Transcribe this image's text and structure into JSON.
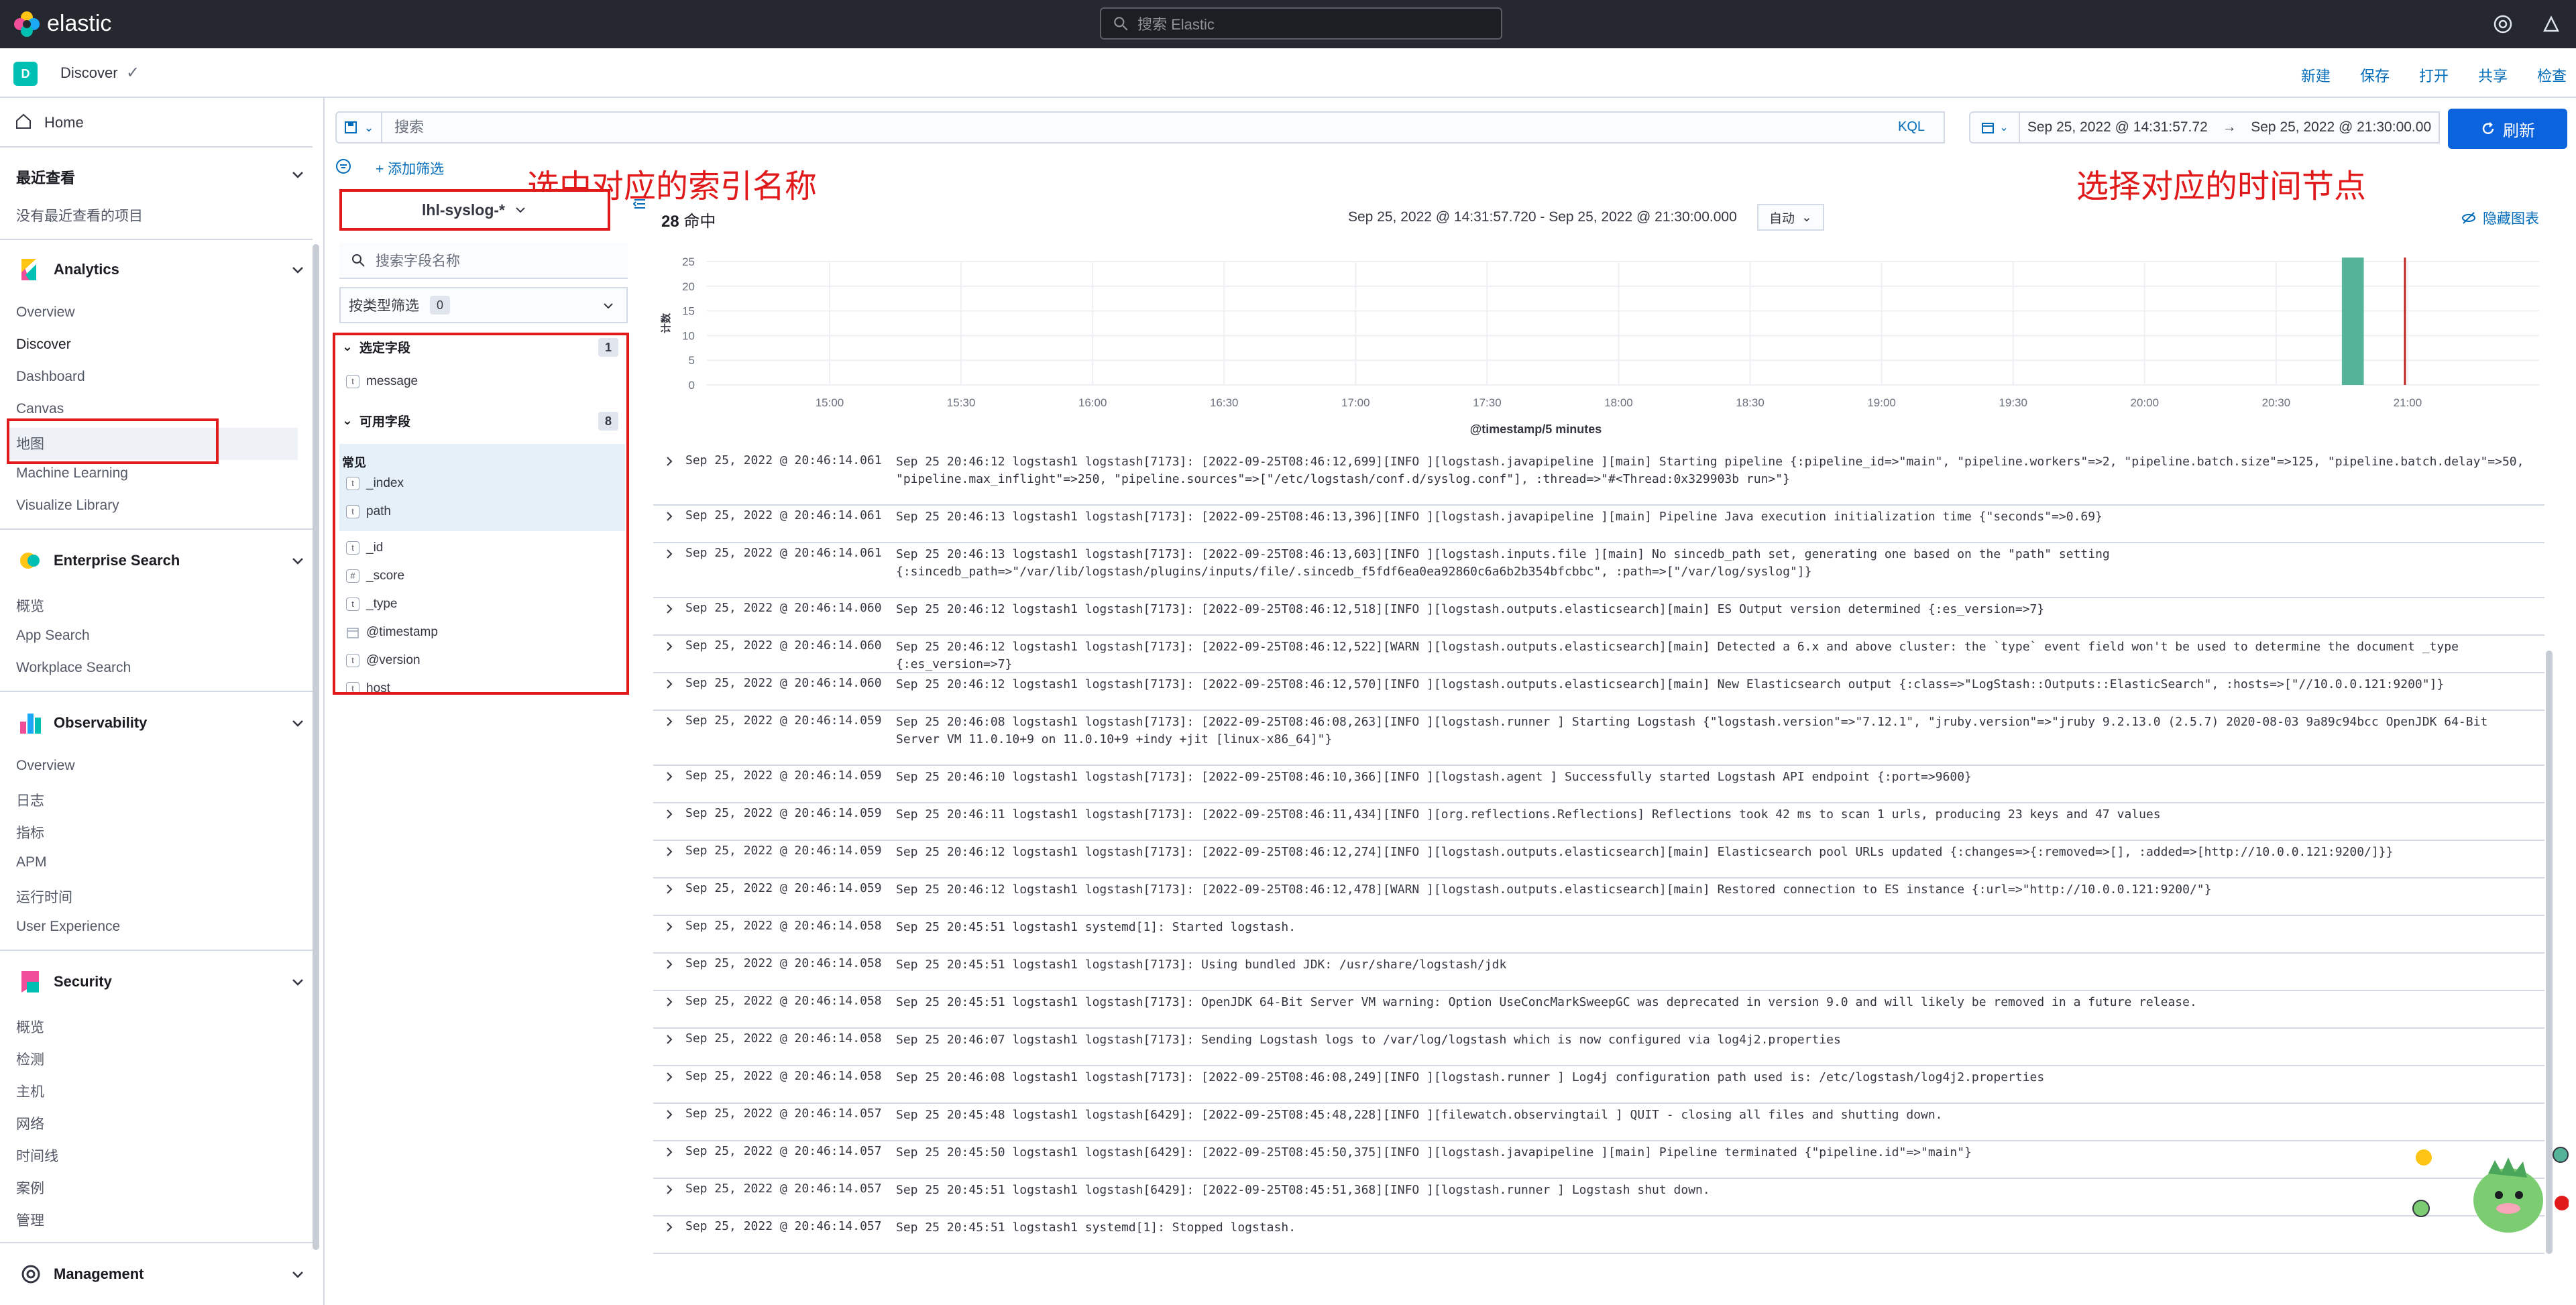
{
  "app": {
    "brand": "elastic",
    "search_placeholder": "搜索 Elastic"
  },
  "breadcrumb": {
    "badge": "D",
    "current": "Discover"
  },
  "top_actions": [
    "新建",
    "保存",
    "打开",
    "共享",
    "检查"
  ],
  "sidebar": {
    "home": "Home",
    "recent_title": "最近查看",
    "recent_empty": "没有最近查看的项目",
    "groups": [
      {
        "title": "Analytics",
        "icon": "analytics-icon",
        "items": [
          "Overview",
          "Discover",
          "Dashboard",
          "Canvas",
          "地图",
          "Machine Learning",
          "Visualize Library"
        ]
      },
      {
        "title": "Enterprise Search",
        "icon": "enterprise-search-icon",
        "items": [
          "概览",
          "App Search",
          "Workplace Search"
        ]
      },
      {
        "title": "Observability",
        "icon": "observability-icon",
        "items": [
          "Overview",
          "日志",
          "指标",
          "APM",
          "运行时间",
          "User Experience"
        ]
      },
      {
        "title": "Security",
        "icon": "security-icon",
        "items": [
          "概览",
          "检测",
          "主机",
          "网络",
          "时间线",
          "案例",
          "管理"
        ]
      },
      {
        "title": "Management",
        "icon": "management-icon",
        "items": []
      }
    ]
  },
  "query": {
    "placeholder": "搜索",
    "language": "KQL",
    "date_start": "Sep 25, 2022 @ 14:31:57.72",
    "date_arrow": "→",
    "date_end": "Sep 25, 2022 @ 21:30:00.00",
    "refresh_label": "刷新",
    "add_filter": "+ 添加筛选"
  },
  "annotations": {
    "index_note": "选中对应的索引名称",
    "time_note": "选择对应的时间节点"
  },
  "fields_panel": {
    "index_pattern": "lhl-syslog-*",
    "search_placeholder": "搜索字段名称",
    "type_filter_label": "按类型筛选",
    "type_filter_count": "0",
    "selected_title": "选定字段",
    "selected_count": "1",
    "selected_fields": [
      {
        "type": "t",
        "name": "message"
      }
    ],
    "available_title": "可用字段",
    "available_count": "8",
    "popular_title": "常见",
    "popular_fields": [
      {
        "type": "t",
        "name": "_index"
      },
      {
        "type": "t",
        "name": "path"
      }
    ],
    "other_fields": [
      {
        "type": "t",
        "name": "_id"
      },
      {
        "type": "#",
        "name": "_score"
      },
      {
        "type": "t",
        "name": "_type"
      },
      {
        "type": "cal",
        "name": "@timestamp"
      },
      {
        "type": "t",
        "name": "@version"
      },
      {
        "type": "t",
        "name": "host"
      }
    ]
  },
  "histogram_header": {
    "hits_count": "28",
    "hits_label": "命中",
    "range": "Sep 25, 2022 @ 14:31:57.720 - Sep 25, 2022 @ 21:30:00.000",
    "interval": "自动",
    "hide_chart": "隐藏图表"
  },
  "chart_data": {
    "type": "bar",
    "xlabel": "@timestamp/5 minutes",
    "ylabel": "计数",
    "ylim": [
      0,
      25
    ],
    "y_ticks": [
      0,
      5,
      10,
      15,
      20,
      25
    ],
    "x_ticks": [
      "15:00",
      "15:30",
      "16:00",
      "16:30",
      "17:00",
      "17:30",
      "18:00",
      "18:30",
      "19:00",
      "19:30",
      "20:00",
      "20:30",
      "21:00"
    ],
    "x_range_minutes": [
      -28,
      390
    ],
    "bars": [
      {
        "start": "20:45",
        "end": "20:50",
        "value": 28
      }
    ],
    "now_marker": "21:00",
    "bar_color": "#54b399",
    "marker_color": "#bd271e"
  },
  "documents": [
    {
      "time": "Sep 25, 2022 @ 20:46:14.061",
      "msg": "Sep 25 20:46:12 logstash1 logstash[7173]: [2022-09-25T08:46:12,699][INFO ][logstash.javapipeline ][main] Starting pipeline {:pipeline_id=>\"main\", \"pipeline.workers\"=>2, \"pipeline.batch.size\"=>125, \"pipeline.batch.delay\"=>50, \"pipeline.max_inflight\"=>250, \"pipeline.sources\"=>[\"/etc/logstash/conf.d/syslog.conf\"], :thread=>\"#<Thread:0x329903b run>\"}"
    },
    {
      "time": "Sep 25, 2022 @ 20:46:14.061",
      "msg": "Sep 25 20:46:13 logstash1 logstash[7173]: [2022-09-25T08:46:13,396][INFO ][logstash.javapipeline ][main] Pipeline Java execution initialization time {\"seconds\"=>0.69}"
    },
    {
      "time": "Sep 25, 2022 @ 20:46:14.061",
      "msg": "Sep 25 20:46:13 logstash1 logstash[7173]: [2022-09-25T08:46:13,603][INFO ][logstash.inputs.file ][main] No sincedb_path set, generating one based on the \"path\" setting {:sincedb_path=>\"/var/lib/logstash/plugins/inputs/file/.sincedb_f5fdf6ea0ea92860c6a6b2b354bfcbbc\", :path=>[\"/var/log/syslog\"]}"
    },
    {
      "time": "Sep 25, 2022 @ 20:46:14.060",
      "msg": "Sep 25 20:46:12 logstash1 logstash[7173]: [2022-09-25T08:46:12,518][INFO ][logstash.outputs.elasticsearch][main] ES Output version determined {:es_version=>7}"
    },
    {
      "time": "Sep 25, 2022 @ 20:46:14.060",
      "msg": "Sep 25 20:46:12 logstash1 logstash[7173]: [2022-09-25T08:46:12,522][WARN ][logstash.outputs.elasticsearch][main] Detected a 6.x and above cluster: the `type` event field won't be used to determine the document _type {:es_version=>7}"
    },
    {
      "time": "Sep 25, 2022 @ 20:46:14.060",
      "msg": "Sep 25 20:46:12 logstash1 logstash[7173]: [2022-09-25T08:46:12,570][INFO ][logstash.outputs.elasticsearch][main] New Elasticsearch output {:class=>\"LogStash::Outputs::ElasticSearch\", :hosts=>[\"//10.0.0.121:9200\"]}"
    },
    {
      "time": "Sep 25, 2022 @ 20:46:14.059",
      "msg": "Sep 25 20:46:08 logstash1 logstash[7173]: [2022-09-25T08:46:08,263][INFO ][logstash.runner ] Starting Logstash {\"logstash.version\"=>\"7.12.1\", \"jruby.version\"=>\"jruby 9.2.13.0 (2.5.7) 2020-08-03 9a89c94bcc OpenJDK 64-Bit Server VM 11.0.10+9 on 11.0.10+9 +indy +jit [linux-x86_64]\"}"
    },
    {
      "time": "Sep 25, 2022 @ 20:46:14.059",
      "msg": "Sep 25 20:46:10 logstash1 logstash[7173]: [2022-09-25T08:46:10,366][INFO ][logstash.agent ] Successfully started Logstash API endpoint {:port=>9600}"
    },
    {
      "time": "Sep 25, 2022 @ 20:46:14.059",
      "msg": "Sep 25 20:46:11 logstash1 logstash[7173]: [2022-09-25T08:46:11,434][INFO ][org.reflections.Reflections] Reflections took 42 ms to scan 1 urls, producing 23 keys and 47 values"
    },
    {
      "time": "Sep 25, 2022 @ 20:46:14.059",
      "msg": "Sep 25 20:46:12 logstash1 logstash[7173]: [2022-09-25T08:46:12,274][INFO ][logstash.outputs.elasticsearch][main] Elasticsearch pool URLs updated {:changes=>{:removed=>[], :added=>[http://10.0.0.121:9200/]}}"
    },
    {
      "time": "Sep 25, 2022 @ 20:46:14.059",
      "msg": "Sep 25 20:46:12 logstash1 logstash[7173]: [2022-09-25T08:46:12,478][WARN ][logstash.outputs.elasticsearch][main] Restored connection to ES instance {:url=>\"http://10.0.0.121:9200/\"}"
    },
    {
      "time": "Sep 25, 2022 @ 20:46:14.058",
      "msg": "Sep 25 20:45:51 logstash1 systemd[1]: Started logstash."
    },
    {
      "time": "Sep 25, 2022 @ 20:46:14.058",
      "msg": "Sep 25 20:45:51 logstash1 logstash[7173]: Using bundled JDK: /usr/share/logstash/jdk"
    },
    {
      "time": "Sep 25, 2022 @ 20:46:14.058",
      "msg": "Sep 25 20:45:51 logstash1 logstash[7173]: OpenJDK 64-Bit Server VM warning: Option UseConcMarkSweepGC was deprecated in version 9.0 and will likely be removed in a future release."
    },
    {
      "time": "Sep 25, 2022 @ 20:46:14.058",
      "msg": "Sep 25 20:46:07 logstash1 logstash[7173]: Sending Logstash logs to /var/log/logstash which is now configured via log4j2.properties"
    },
    {
      "time": "Sep 25, 2022 @ 20:46:14.058",
      "msg": "Sep 25 20:46:08 logstash1 logstash[7173]: [2022-09-25T08:46:08,249][INFO ][logstash.runner ] Log4j configuration path used is: /etc/logstash/log4j2.properties"
    },
    {
      "time": "Sep 25, 2022 @ 20:46:14.057",
      "msg": "Sep 25 20:45:48 logstash1 logstash[6429]: [2022-09-25T08:45:48,228][INFO ][filewatch.observingtail ] QUIT - closing all files and shutting down."
    },
    {
      "time": "Sep 25, 2022 @ 20:46:14.057",
      "msg": "Sep 25 20:45:50 logstash1 logstash[6429]: [2022-09-25T08:45:50,375][INFO ][logstash.javapipeline ][main] Pipeline terminated {\"pipeline.id\"=>\"main\"}"
    },
    {
      "time": "Sep 25, 2022 @ 20:46:14.057",
      "msg": "Sep 25 20:45:51 logstash1 logstash[6429]: [2022-09-25T08:45:51,368][INFO ][logstash.runner ] Logstash shut down."
    },
    {
      "time": "Sep 25, 2022 @ 20:46:14.057",
      "msg": "Sep 25 20:45:51 logstash1 systemd[1]: Stopped logstash."
    }
  ],
  "colors": {
    "accent": "#006bb8",
    "primary_button": "#0b64dd",
    "annotation": "#e0191b",
    "header_bg": "#25282f"
  }
}
